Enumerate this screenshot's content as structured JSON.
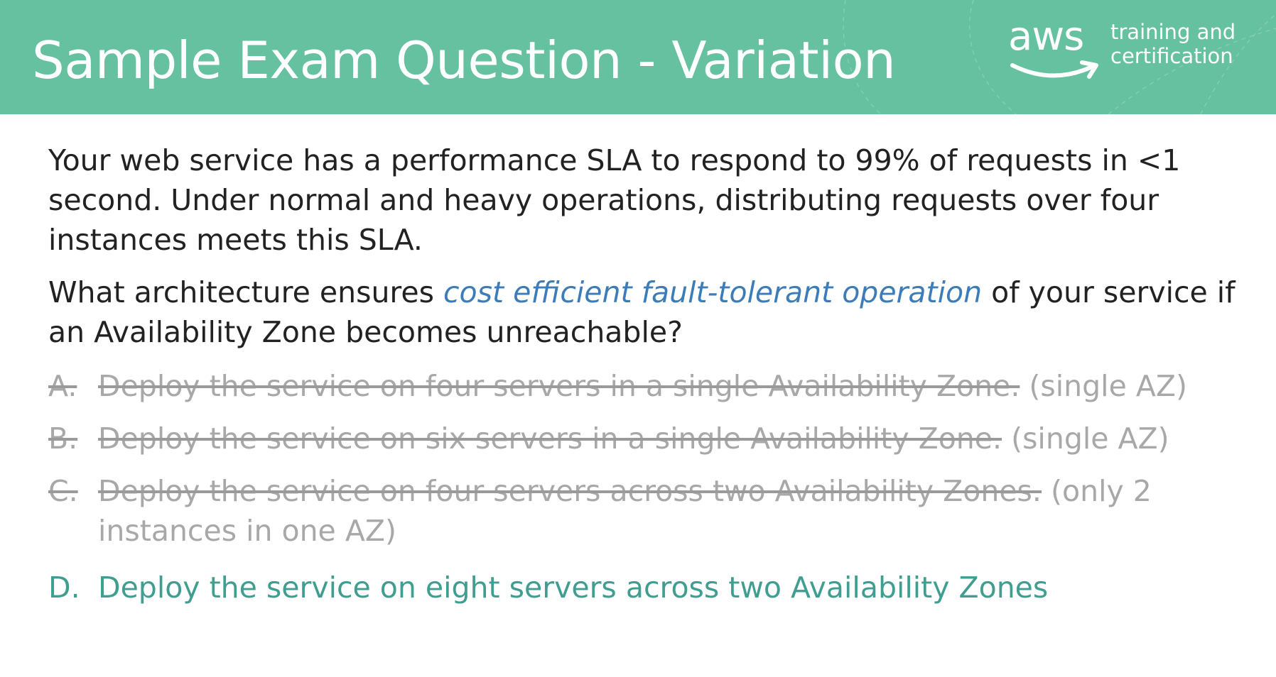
{
  "header": {
    "title": "Sample Exam Question - Variation",
    "logo": {
      "word": "aws",
      "tagline_line1": "training and",
      "tagline_line2": "certification"
    }
  },
  "question": {
    "paragraph1": "Your web service has a performance SLA to respond to 99% of requests in <1 second. Under normal and heavy operations, distributing requests over four instances meets this SLA.",
    "paragraph2_before": "What architecture ensures ",
    "paragraph2_emphasis": "cost efficient fault-tolerant operation",
    "paragraph2_after": " of your service if an Availability Zone becomes unreachable?"
  },
  "options": [
    {
      "letter": "A.",
      "text": "Deploy the service on four servers in a single Availability Zone.",
      "note": " (single AZ)",
      "status": "eliminated"
    },
    {
      "letter": "B.",
      "text": "Deploy the service on six servers in a single Availability Zone.",
      "note": " (single AZ)",
      "status": "eliminated"
    },
    {
      "letter": "C.",
      "text": "Deploy the service on four servers across two Availability Zones.",
      "note": " (only 2 instances in one AZ)",
      "status": "eliminated"
    },
    {
      "letter": "D.",
      "text": "Deploy the service on eight servers across two Availability Zones",
      "note": "",
      "status": "correct"
    }
  ],
  "colors": {
    "header_bg": "#66c1a0",
    "emphasis": "#3c7cb8",
    "eliminated_text": "#a8a8a8",
    "correct_text": "#3f9e90",
    "body_text": "#222222"
  },
  "icons": {
    "logo_smile": "smile-arrow-icon"
  }
}
